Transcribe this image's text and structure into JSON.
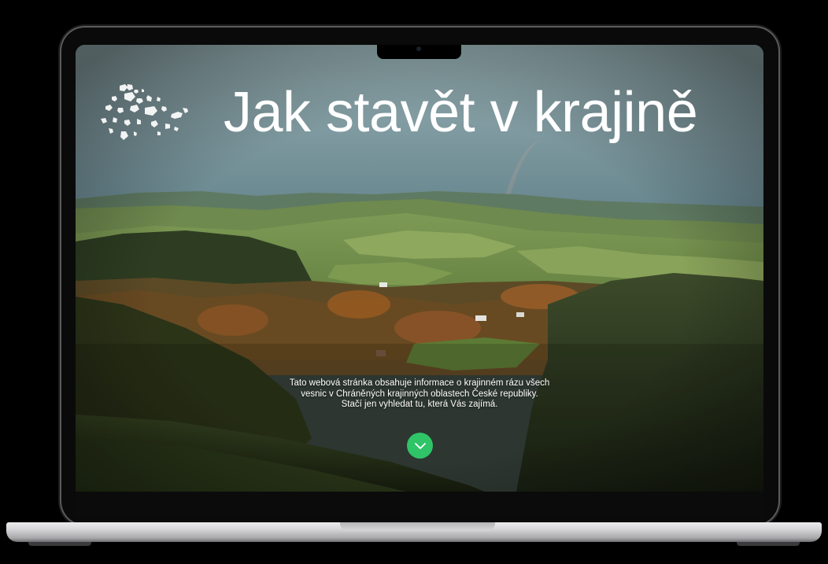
{
  "hero": {
    "title": "Jak stavět v krajině",
    "logo_icon": "map-regions-logo-icon",
    "description_lines": [
      "Tato webová stránka obsahuje informace o krajinném rázu všech",
      "vesnic v Chráněných krajinných oblastech České republiky.",
      "Stačí jen vyhledat tu, která Vás zajímá."
    ],
    "scroll_button_icon": "chevron-down-icon"
  },
  "colors": {
    "accent": "#2fc468",
    "title_text": "#ffffff"
  }
}
